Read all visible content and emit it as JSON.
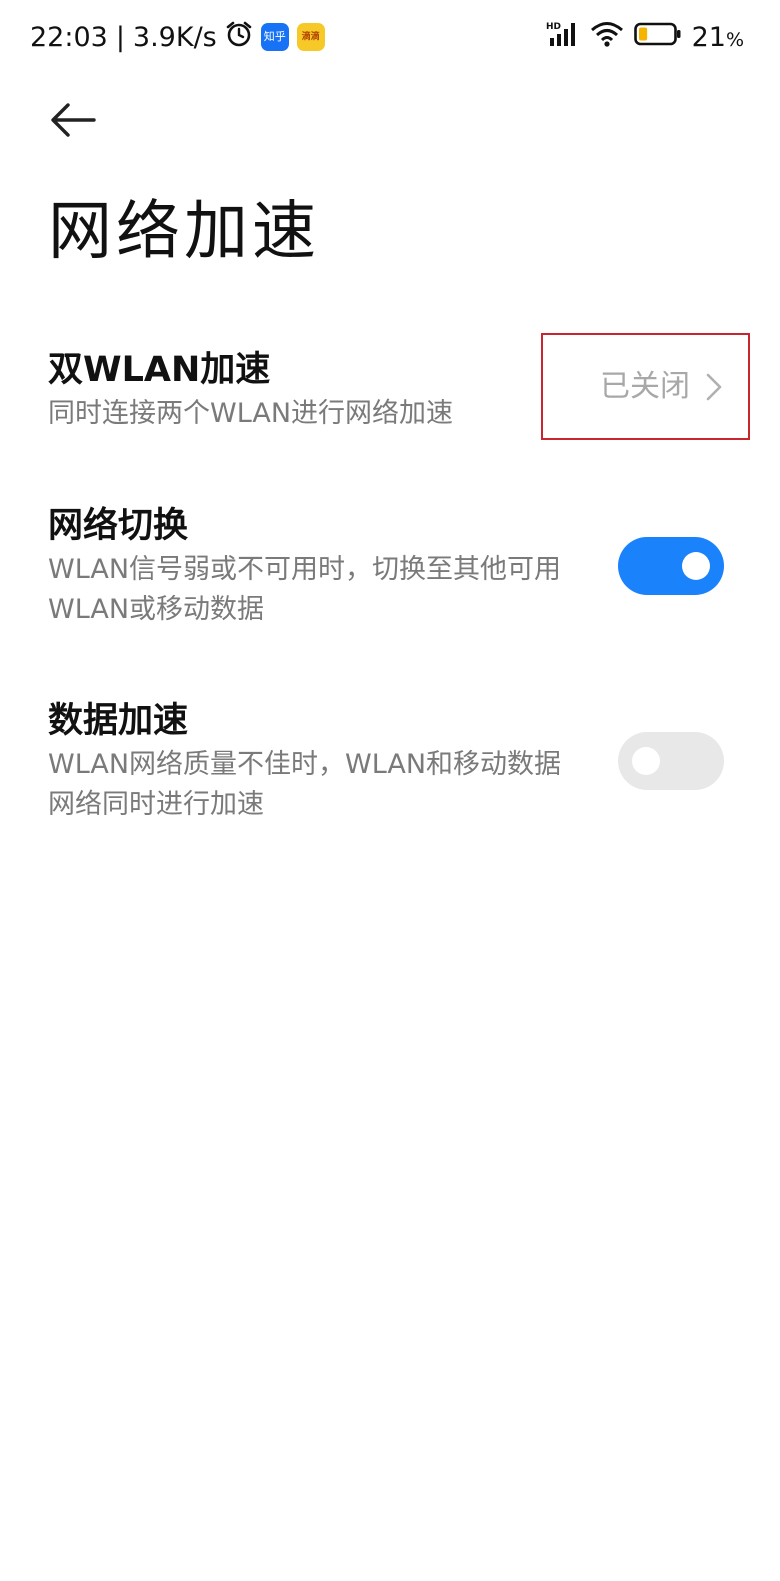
{
  "status_bar": {
    "time": "22:03",
    "separator": "|",
    "speed": "3.9K/s",
    "icons": [
      "alarm-icon",
      "zhihu-app-icon",
      "yellow-app-icon",
      "hd-signal-icon",
      "wifi-icon",
      "battery-icon"
    ],
    "zhihu_label": "知乎",
    "yellow_app_label": "滴滴",
    "battery_percent": "21",
    "battery_unit": "%",
    "battery_level": 0.21,
    "battery_color": "#f5b400"
  },
  "header": {
    "back_icon": "arrow-left-icon",
    "title": "网络加速"
  },
  "settings": [
    {
      "title": "双WLAN加速",
      "description": "同时连接两个WLAN进行网络加速",
      "value": "已关闭",
      "control": "chevron-right-icon"
    },
    {
      "title": "网络切换",
      "description": "WLAN信号弱或不可用时，切换至其他可用WLAN或移动数据",
      "control": "toggle",
      "enabled": true
    },
    {
      "title": "数据加速",
      "description": "WLAN网络质量不佳时，WLAN和移动数据网络同时进行加速",
      "control": "toggle",
      "enabled": false
    }
  ],
  "colors": {
    "accent": "#1a82fb",
    "highlight_border": "#c8262f",
    "toggle_off": "#e8e8e8",
    "secondary_text": "#7a7a7a"
  }
}
